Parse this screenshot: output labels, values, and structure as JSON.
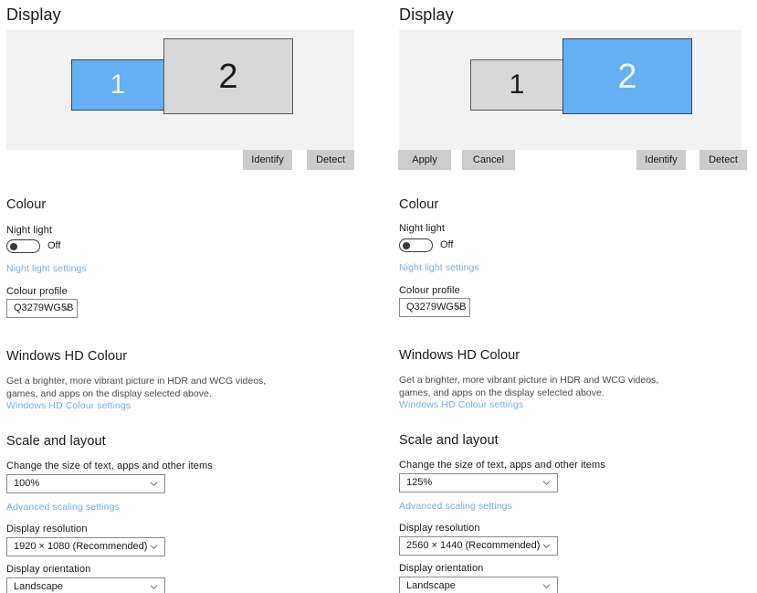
{
  "panels": [
    {
      "id": "left",
      "page_title": "Display",
      "monitors": [
        {
          "number": "1",
          "state": "selected"
        },
        {
          "number": "2",
          "state": "unselected"
        }
      ],
      "arrangement_buttons": [
        {
          "label": "Identify",
          "name": "identify-button"
        },
        {
          "label": "Detect",
          "name": "detect-button"
        }
      ],
      "commit_buttons": [],
      "colour": {
        "heading": "Colour",
        "night_light_label": "Night light",
        "night_light_state": "Off",
        "night_light_on": false,
        "night_light_link": "Night light settings",
        "colour_profile_label": "Colour profile",
        "colour_profile_value": "Q3279WG5B"
      },
      "hd_colour": {
        "heading": "Windows HD Colour",
        "description": "Get a brighter, more vibrant picture in HDR and WCG videos, games, and apps on the display selected above.",
        "link": "Windows HD Colour settings"
      },
      "scale_layout": {
        "heading": "Scale and layout",
        "scale_label": "Change the size of text, apps and other items",
        "scale_value": "100%",
        "advanced_link": "Advanced scaling settings",
        "resolution_label": "Display resolution",
        "resolution_value": "1920 × 1080 (Recommended)",
        "orientation_label": "Display orientation",
        "orientation_value": "Landscape"
      }
    },
    {
      "id": "right",
      "page_title": "Display",
      "monitors": [
        {
          "number": "1",
          "state": "unselected"
        },
        {
          "number": "2",
          "state": "selected"
        }
      ],
      "arrangement_buttons": [
        {
          "label": "Identify",
          "name": "identify-button"
        },
        {
          "label": "Detect",
          "name": "detect-button"
        }
      ],
      "commit_buttons": [
        {
          "label": "Apply",
          "name": "apply-button"
        },
        {
          "label": "Cancel",
          "name": "cancel-button"
        }
      ],
      "colour": {
        "heading": "Colour",
        "night_light_label": "Night light",
        "night_light_state": "Off",
        "night_light_on": false,
        "night_light_link": "Night light settings",
        "colour_profile_label": "Colour profile",
        "colour_profile_value": "Q3279WG5B"
      },
      "hd_colour": {
        "heading": "Windows HD Colour",
        "description": "Get a brighter, more vibrant picture in HDR and WCG videos, games, and apps on the display selected above.",
        "link": "Windows HD Colour settings"
      },
      "scale_layout": {
        "heading": "Scale and layout",
        "scale_label": "Change the size of text, apps and other items",
        "scale_value": "125%",
        "advanced_link": "Advanced scaling settings",
        "resolution_label": "Display resolution",
        "resolution_value": "2560 × 1440 (Recommended)",
        "orientation_label": "Display orientation",
        "orientation_value": "Landscape"
      }
    }
  ],
  "colors": {
    "accent_blue": "#64b0f2",
    "link_blue": "#7aaee0",
    "canvas_gray": "#f2f2f2",
    "monitor_gray": "#d8d8d8",
    "button_gray": "#cccccc"
  }
}
